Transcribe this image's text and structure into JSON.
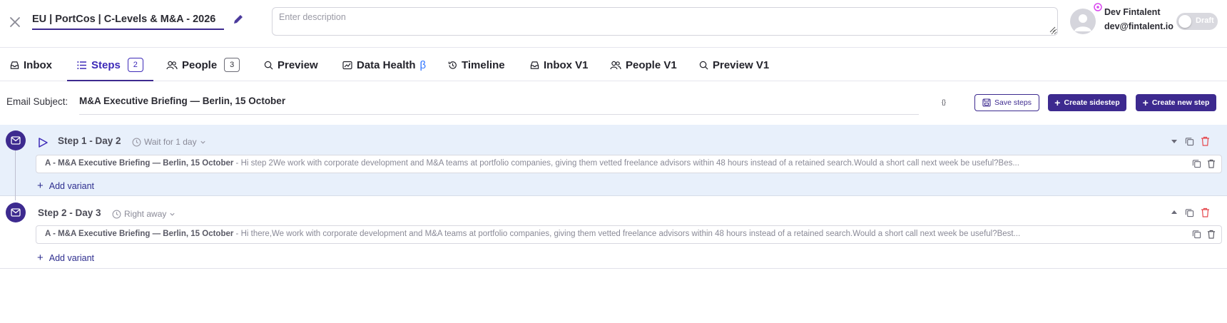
{
  "header": {
    "title": "EU | PortCos | C-Levels & M&A - 2026",
    "description_placeholder": "Enter description",
    "user_name": "Dev Fintalent",
    "user_email": "dev@fintalent.io",
    "draft_label": "Draft"
  },
  "tabs": [
    {
      "label": "Inbox",
      "icon": "inbox-icon"
    },
    {
      "label": "Steps",
      "icon": "list-icon",
      "count": "2",
      "active": true
    },
    {
      "label": "People",
      "icon": "people-icon",
      "count": "3"
    },
    {
      "label": "Preview",
      "icon": "search-icon"
    },
    {
      "label": "Data Health",
      "icon": "chart-icon",
      "suffix": "β"
    },
    {
      "label": "Timeline",
      "icon": "history-icon"
    },
    {
      "label": "Inbox V1",
      "icon": "inbox-icon"
    },
    {
      "label": "People V1",
      "icon": "people-icon"
    },
    {
      "label": "Preview V1",
      "icon": "search-icon"
    }
  ],
  "subject": {
    "label": "Email Subject:",
    "value": "M&A Executive Briefing — Berlin, 15 October",
    "braces": "{}"
  },
  "actions": {
    "save_steps": "Save steps",
    "create_sidestep": "Create sidestep",
    "create_new_step": "Create new step"
  },
  "steps": [
    {
      "title": "Step 1 - Day 2",
      "wait": "Wait for 1 day",
      "variant_label": "A - M&A Executive Briefing — Berlin, 15 October",
      "variant_preview": " - Hi step 2We work with corporate development and M&A teams at portfolio companies, giving them vetted freelance advisors within 48 hours instead of a retained search.Would a short call next week be useful?Bes...",
      "add_variant": "Add variant"
    },
    {
      "title": "Step 2 - Day 3",
      "wait": "Right away",
      "variant_label": "A - M&A Executive Briefing — Berlin, 15 October",
      "variant_preview": " - Hi there,We work with corporate development and M&A teams at portfolio companies, giving them vetted freelance advisors within 48 hours instead of a retained search.Would a short call next week be useful?Best...",
      "add_variant": "Add variant"
    }
  ],
  "colors": {
    "accent": "#3d2a8f",
    "step_active_bg": "#e8f0fb",
    "danger": "#e5484d",
    "beta": "#2f74ff"
  }
}
